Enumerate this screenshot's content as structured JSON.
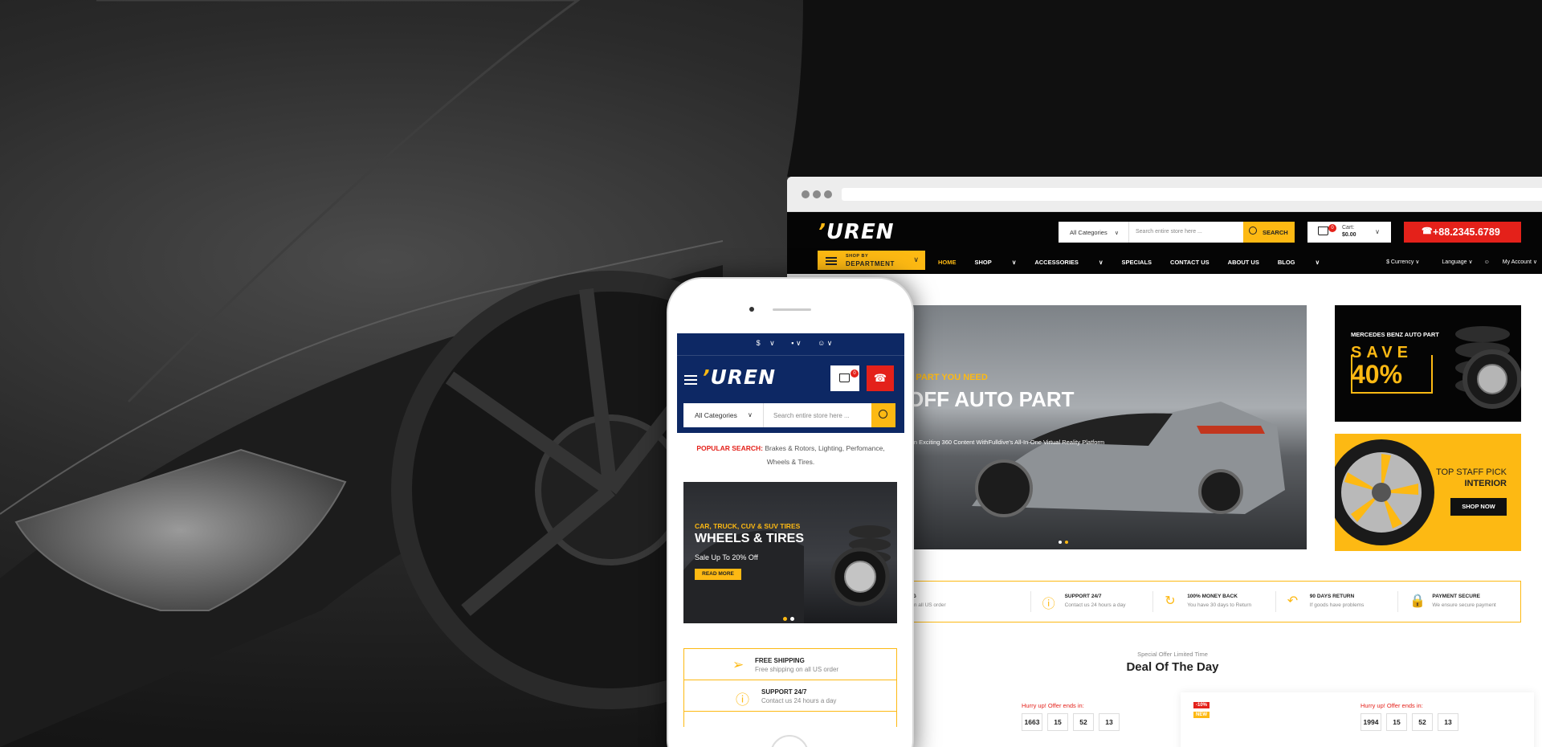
{
  "desktop": {
    "header": {
      "logo": "UREN",
      "search": {
        "category": "All Categories",
        "placeholder": "Search entire store here ...",
        "button": "SEARCH"
      },
      "cart": {
        "count": "0",
        "label": "Cart:",
        "total": "$0.00"
      },
      "phone": "+88.2345.6789"
    },
    "nav": {
      "department_small": "SHOP BY",
      "department_large": "DEPARTMENT",
      "items": [
        "HOME",
        "SHOP",
        "ACCESSORIES",
        "SPECIALS",
        "CONTACT US",
        "ABOUT US",
        "BLOG"
      ],
      "utility": [
        "$ Currency",
        "Language",
        "My Account"
      ]
    },
    "slider": {
      "subtitle": "E PART YOU NEED",
      "title": "OFF AUTO PART",
      "description": "e in Exciting 360 Content WithFulldive's All-In-One Virtual Reality Platform"
    },
    "banner1": {
      "title": "MERCEDES BENZ AUTO PART",
      "save": "SAVE",
      "percent": "40%"
    },
    "banner2": {
      "title": "TOP STAFF PICK",
      "subtitle": "INTERIOR",
      "button": "SHOP NOW"
    },
    "features": [
      {
        "icon": "truck-icon",
        "title": "NG",
        "subtitle": "g in all US order"
      },
      {
        "icon": "support-icon",
        "title": "SUPPORT 24/7",
        "subtitle": "Contact us 24 hours a day"
      },
      {
        "icon": "refresh-icon",
        "title": "100% MONEY BACK",
        "subtitle": "You have 30 days to Return"
      },
      {
        "icon": "return-icon",
        "title": "90 DAYS RETURN",
        "subtitle": "If goods have problems"
      },
      {
        "icon": "lock-icon",
        "title": "PAYMENT SECURE",
        "subtitle": "We ensure secure payment"
      }
    ],
    "deal": {
      "small": "Special Offer Limited Time",
      "title": "Deal Of The Day",
      "hurry": "Hurry up! Offer ends in:",
      "countdown1": [
        "1663",
        "15",
        "52",
        "13"
      ],
      "countdown2": [
        "1994",
        "15",
        "52",
        "13"
      ],
      "discount_badge": "-10%",
      "new_badge": "NEW"
    }
  },
  "mobile": {
    "utility": [
      "$",
      "",
      ""
    ],
    "logo": "UREN",
    "cart_count": "0",
    "search": {
      "category": "All Categories",
      "placeholder": "Search entire store here ..."
    },
    "popular": {
      "label": "POPULAR SEARCH:",
      "text": "Brakes & Rotors, Lighting, Perfomance, Wheels & Tires."
    },
    "slider": {
      "subtitle": "CAR, TRUCK, CUV & SUV TIRES",
      "title": "WHEELS & TIRES",
      "sale": "Sale Up To 20% Off",
      "button": "READ MORE"
    },
    "features": [
      {
        "title": "FREE SHIPPING",
        "subtitle": "Free shipping on all US order"
      },
      {
        "title": "SUPPORT 24/7",
        "subtitle": "Contact us 24 hours a day"
      }
    ]
  },
  "colors": {
    "accent": "#fdb913",
    "red": "#e4211a",
    "navy": "#0d2864",
    "dark": "#050505"
  }
}
